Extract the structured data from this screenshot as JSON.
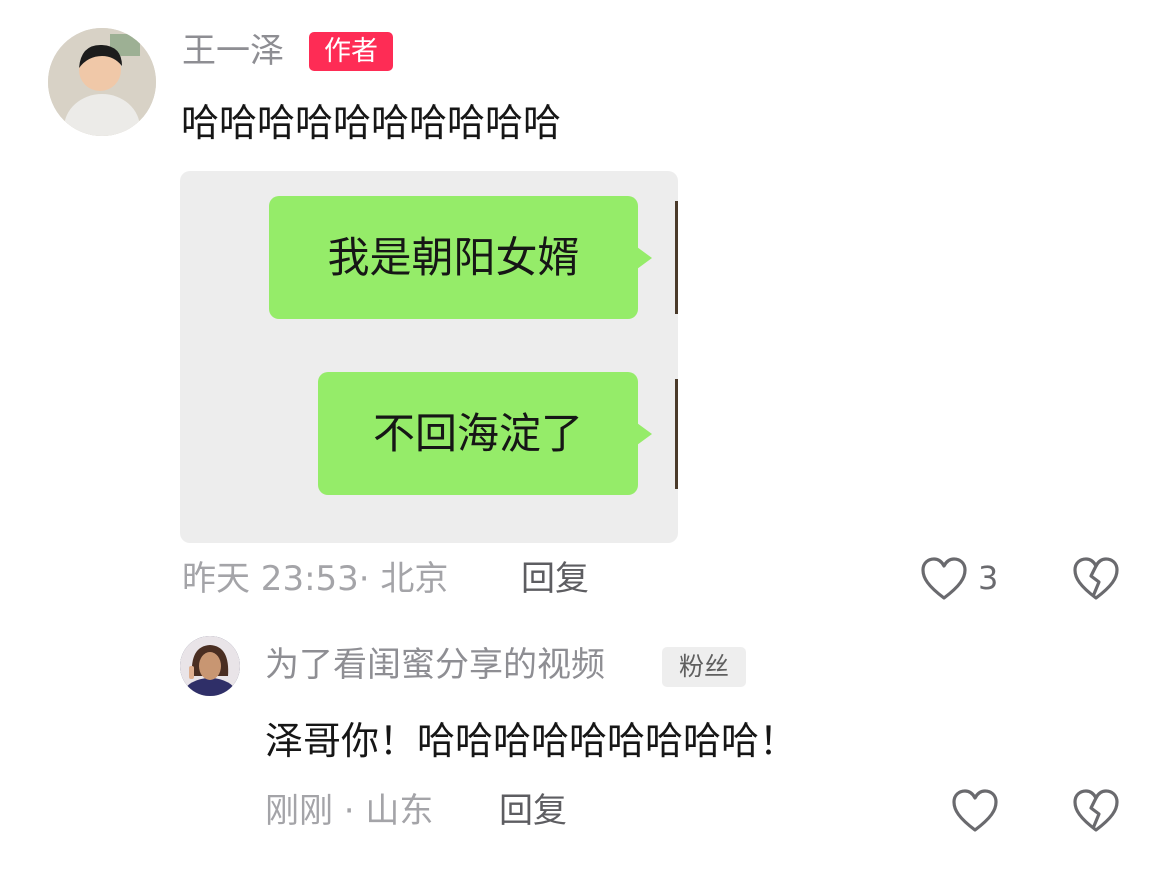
{
  "comment": {
    "username": "王一泽",
    "badge": "作者",
    "text": "哈哈哈哈哈哈哈哈哈哈",
    "screenshot": {
      "bubble_1": "我是朝阳女婿",
      "bubble_2": "不回海淀了"
    },
    "time_location": "昨天 23:53· 北京",
    "reply_label": "回复",
    "like_count": "3"
  },
  "reply": {
    "username": "为了看闺蜜分享的视频",
    "badge": "粉丝",
    "text": "泽哥你！哈哈哈哈哈哈哈哈哈！",
    "time_location": "刚刚 · 山东",
    "reply_label": "回复"
  },
  "icons": {
    "like": "heart-outline-icon",
    "dislike": "broken-heart-icon"
  },
  "colors": {
    "author_badge": "#fe2c55",
    "chat_bubble": "#95ec69"
  }
}
